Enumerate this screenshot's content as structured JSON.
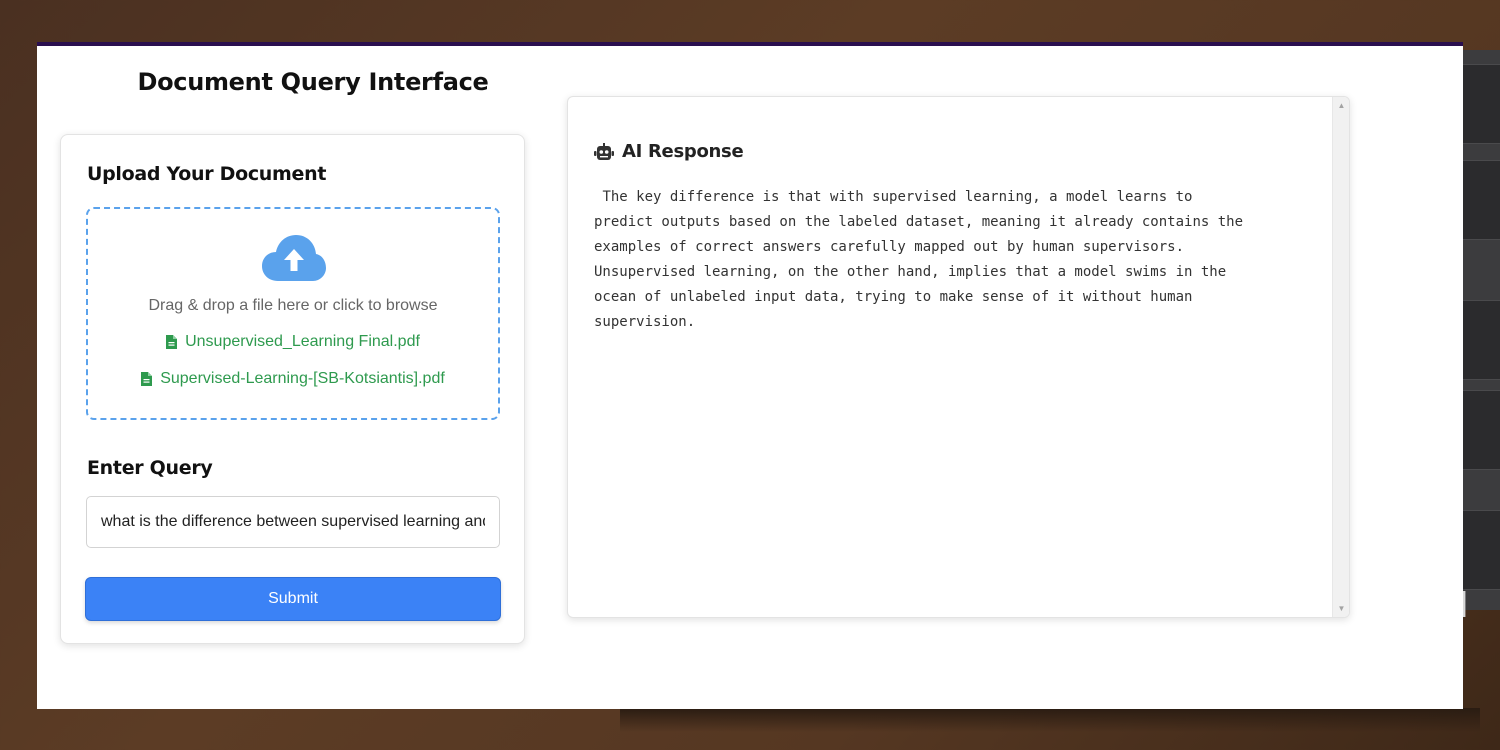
{
  "app": {
    "title": "Document Query Interface"
  },
  "upload": {
    "heading": "Upload Your Document",
    "dropzone_text": "Drag & drop a file here or click to browse",
    "files": [
      {
        "name": "Unsupervised_Learning Final.pdf"
      },
      {
        "name": "Supervised-Learning-[SB-Kotsiantis].pdf"
      }
    ]
  },
  "query": {
    "heading": "Enter Query",
    "value": "what is the difference between supervised learning and unsupervised learning?",
    "submit_label": "Submit"
  },
  "response": {
    "heading": "AI Response",
    "text": " The key difference is that with supervised learning, a model learns to\npredict outputs based on the labeled dataset, meaning it already contains the\nexamples of correct answers carefully mapped out by human supervisors.\nUnsupervised learning, on the other hand, implies that a model swims in the\nocean of unlabeled input data, trying to make sense of it without human\nsupervision."
  },
  "colors": {
    "accent": "#3b82f6",
    "file_green": "#2e9a4e",
    "dropzone_border": "#5aa2ec",
    "window_top_border": "#2a0f4f"
  },
  "icons": {
    "upload": "cloud-upload-icon",
    "file": "file-icon",
    "response": "robot-icon"
  },
  "background": {
    "keyboard_glyph": "N"
  }
}
